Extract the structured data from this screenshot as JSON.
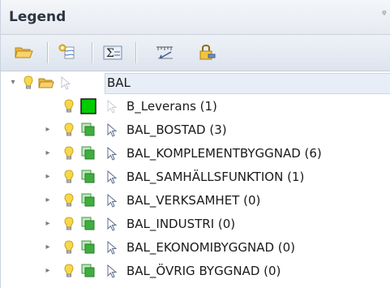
{
  "panel": {
    "title": "Legend",
    "pin_glyph": "ᵠ"
  },
  "toolbar": {
    "buttons": [
      {
        "name": "open-folder-icon"
      },
      {
        "name": "add-layer-icon"
      },
      {
        "name": "sum-icon"
      },
      {
        "name": "measure-icon"
      },
      {
        "name": "lock-icon"
      }
    ]
  },
  "tree": {
    "root": {
      "label": "BAL",
      "expanded": true
    },
    "children": [
      {
        "label": "B_Leverans (1)",
        "has_expander": false,
        "swatch": "#00cc00"
      },
      {
        "label": "BAL_BOSTAD (3)",
        "has_expander": true
      },
      {
        "label": "BAL_KOMPLEMENTBYGGNAD (6)",
        "has_expander": true
      },
      {
        "label": "BAL_SAMHÄLLSFUNKTION (1)",
        "has_expander": true
      },
      {
        "label": "BAL_VERKSAMHET (0)",
        "has_expander": true
      },
      {
        "label": "BAL_INDUSTRI (0)",
        "has_expander": true
      },
      {
        "label": "BAL_EKONOMIBYGGNAD (0)",
        "has_expander": true
      },
      {
        "label": "BAL_ÖVRIG BYGGNAD (0)",
        "has_expander": true
      }
    ]
  },
  "colors": {
    "bulb": "#f2d23a",
    "folder": "#f0c24a",
    "layer_icon": "#3fae3f",
    "pointer": "#6a7fa0"
  }
}
